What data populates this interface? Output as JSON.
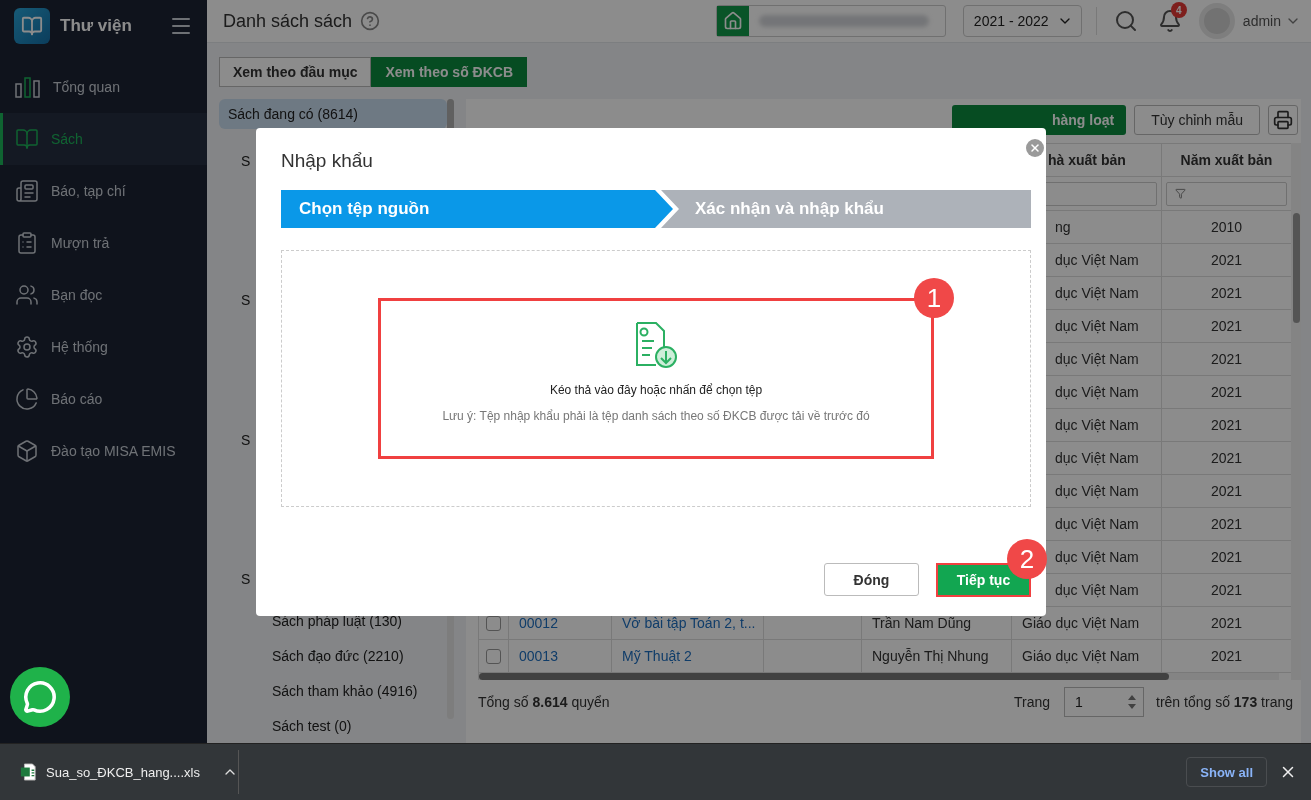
{
  "sidebar": {
    "title": "Thư viện",
    "items": [
      {
        "label": "Tổng quan",
        "kind": "overview",
        "selected": false
      },
      {
        "label": "Sách",
        "kind": "books",
        "selected": true
      },
      {
        "label": "Báo, tạp chí",
        "kind": "news",
        "selected": false
      },
      {
        "label": "Mượn trả",
        "kind": "loan",
        "selected": false
      },
      {
        "label": "Bạn đọc",
        "kind": "readers",
        "selected": false
      },
      {
        "label": "Hệ thống",
        "kind": "system",
        "selected": false
      },
      {
        "label": "Báo cáo",
        "kind": "report",
        "selected": false
      },
      {
        "label": "Đào tạo MISA EMIS",
        "kind": "training",
        "selected": false
      }
    ]
  },
  "header": {
    "title": "Danh sách sách",
    "school_year": "2021 - 2022",
    "notification_count": "4",
    "user": "admin"
  },
  "view_tabs": [
    {
      "label": "Xem theo đầu mục",
      "selected": false
    },
    {
      "label": "Xem theo số ĐKCB",
      "selected": true
    }
  ],
  "categories": {
    "top": {
      "label": "Sách đang có (8614)",
      "selected": true
    },
    "groups": [
      {
        "label": "S",
        "selected": false
      },
      {
        "label": "S",
        "selected": false
      },
      {
        "label": "S",
        "selected": false
      },
      {
        "label": "S",
        "selected": false
      }
    ],
    "items": [
      {
        "label": "Sách pháp luật (130)",
        "selected": false
      },
      {
        "label": "Sách đạo đức (2210)",
        "selected": false
      },
      {
        "label": "Sách tham khảo (4916)",
        "selected": false
      },
      {
        "label": "Sách test (0)",
        "selected": false
      }
    ]
  },
  "toolbar": {
    "bulk_edit": "hàng loạt",
    "customize": "Tùy chỉnh mẫu"
  },
  "table": {
    "columns": {
      "publisher": "hà xuất bản",
      "year": "Năm xuất bản"
    },
    "rows": [
      {
        "kind": "partial",
        "publisher": "ng",
        "year": "2010"
      },
      {
        "kind": "partial",
        "publisher": "dục Việt Nam",
        "year": "2021"
      },
      {
        "kind": "partial",
        "publisher": "dục Việt Nam",
        "year": "2021"
      },
      {
        "kind": "partial",
        "publisher": "dục Việt Nam",
        "year": "2021"
      },
      {
        "kind": "partial",
        "publisher": "dục Việt Nam",
        "year": "2021"
      },
      {
        "kind": "partial",
        "publisher": "dục Việt Nam",
        "year": "2021"
      },
      {
        "kind": "partial",
        "publisher": "dục Việt Nam",
        "year": "2021"
      },
      {
        "kind": "partial",
        "publisher": "dục Việt Nam",
        "year": "2021"
      },
      {
        "kind": "partial",
        "publisher": "dục Việt Nam",
        "year": "2021"
      },
      {
        "kind": "partial",
        "publisher": "dục Việt Nam",
        "year": "2021"
      },
      {
        "kind": "partial",
        "publisher": "dục Việt Nam",
        "year": "2021"
      },
      {
        "kind": "partial",
        "publisher": "dục Việt Nam",
        "year": "2021"
      },
      {
        "kind": "full",
        "checked": false,
        "code": "00012",
        "title": "Vở bài tập Toán 2, t...",
        "author": "Trần Nam Dũng",
        "publisher": "Giáo dục Việt Nam",
        "year": "2021"
      },
      {
        "kind": "full",
        "checked": false,
        "code": "00013",
        "title": "Mỹ Thuật 2",
        "author": "Nguyễn Thị Nhung",
        "publisher": "Giáo dục Việt Nam",
        "year": "2021"
      }
    ]
  },
  "footer": {
    "count_text": "Tổng số **8.614** quyển",
    "page_label": "Trang",
    "page": "1",
    "total_text": "trên tổng số **173** trang"
  },
  "modal": {
    "title": "Nhập khẩu",
    "steps": [
      {
        "label": "Chọn tệp nguồn",
        "selected": true
      },
      {
        "label": "Xác nhận và nhập khẩu",
        "selected": false
      }
    ],
    "drop_text": "Kéo thả vào đây hoặc nhấn để chọn tệp",
    "note": "Lưu ý: Tệp nhập khẩu phải là tệp danh sách theo số ĐKCB được tải về trước đó",
    "buttons": {
      "close": "Đóng",
      "next": "Tiếp tục"
    },
    "markers": [
      "1",
      "2"
    ]
  },
  "download_bar": {
    "file": "Sua_so_ĐKCB_hang....xls",
    "show_all": "Show all"
  }
}
